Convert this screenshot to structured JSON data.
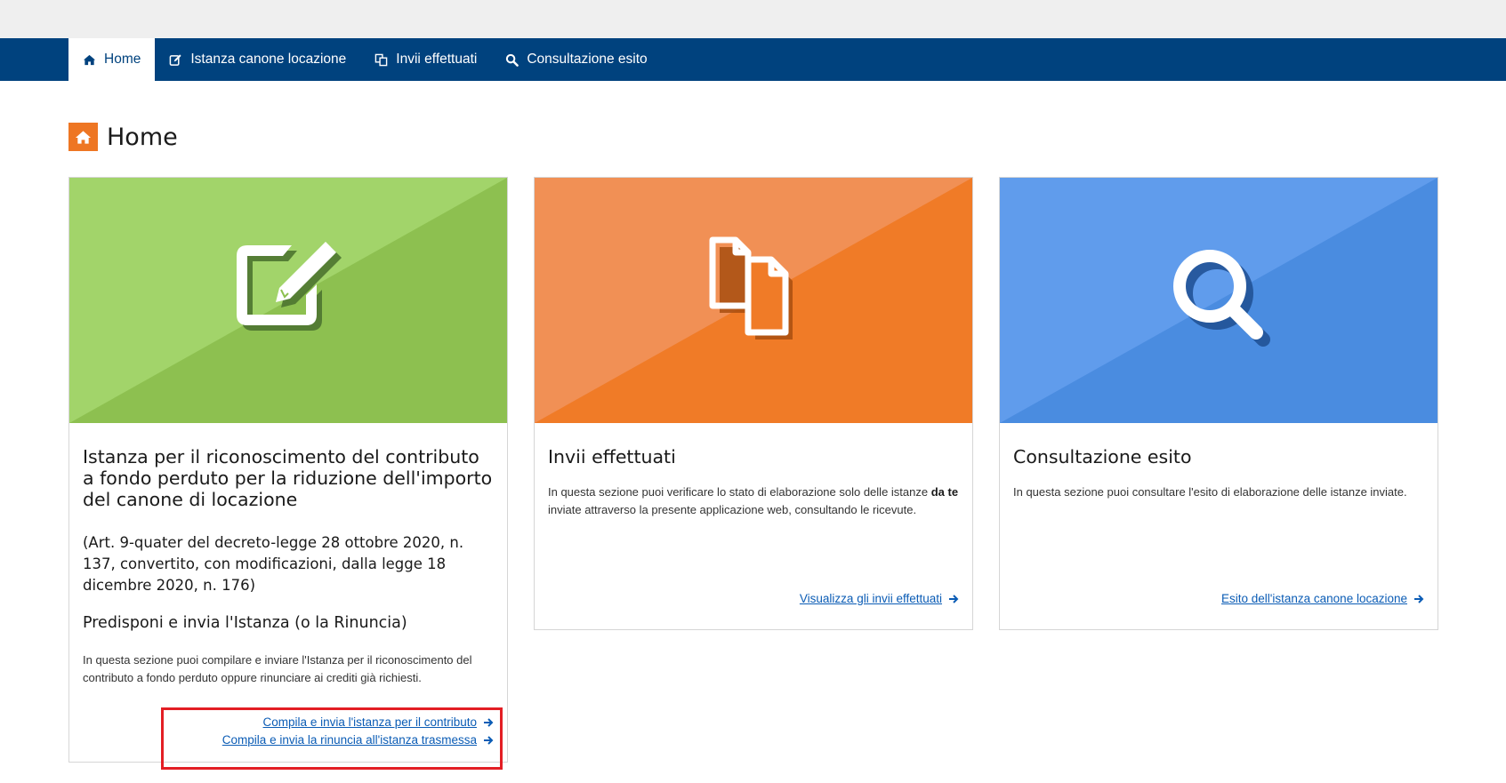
{
  "nav": {
    "items": [
      {
        "label": "Home",
        "icon": "home-icon",
        "active": true
      },
      {
        "label": "Istanza canone locazione",
        "icon": "edit-icon",
        "active": false
      },
      {
        "label": "Invii effettuati",
        "icon": "copy-icon",
        "active": false
      },
      {
        "label": "Consultazione esito",
        "icon": "search-icon",
        "active": false
      }
    ]
  },
  "page": {
    "title": "Home",
    "icon": "home-icon"
  },
  "cards": [
    {
      "title": "Istanza per il riconoscimento del contributo a fondo perduto per la riduzione dell'importo del canone di locazione",
      "subtitle": "(Art. 9-quater del decreto-legge 28 ottobre 2020, n. 137, convertito, con modificazioni, dalla legge 18 dicembre 2020, n. 176)",
      "heading": "Predisponi e invia l'Istanza (o la Rinuncia)",
      "text": "In questa sezione puoi compilare e inviare l'Istanza per il riconoscimento del contributo a fondo perduto oppure rinunciare ai crediti già richiesti.",
      "links": [
        "Compila e invia l'istanza per il contributo",
        "Compila e invia la rinuncia all'istanza trasmessa"
      ],
      "color": "#8dc050",
      "icon": "edit-icon"
    },
    {
      "title": "Invii effettuati",
      "text_before": "In questa sezione puoi verificare lo stato di elaborazione solo delle istanze",
      "text_bold": "da te",
      "text_after": "inviate attraverso la presente applicazione web, consultando le ricevute.",
      "links": [
        "Visualizza gli invii effettuati"
      ],
      "color": "#f07b27",
      "icon": "copy-icon"
    },
    {
      "title": "Consultazione esito",
      "text": "In questa sezione puoi consultare l'esito di elaborazione delle istanze inviate.",
      "links": [
        "Esito dell'istanza canone locazione"
      ],
      "color": "#4a8ce0",
      "icon": "search-icon"
    }
  ],
  "colors": {
    "nav_bg": "#00427e",
    "accent_orange": "#ee7623",
    "link": "#0b5cb5",
    "highlight_border": "#e31e24"
  }
}
